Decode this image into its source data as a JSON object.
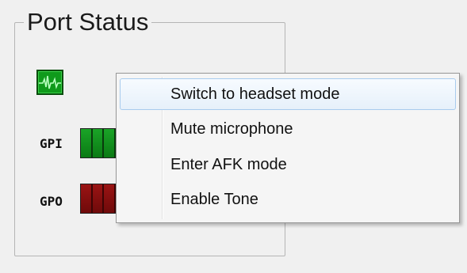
{
  "group": {
    "title": "Port Status"
  },
  "ports": {
    "gpi_label": "GPI",
    "gpo_label": "GPO"
  },
  "icons": {
    "activity": "pulse-icon"
  },
  "colors": {
    "gpi_led": "#0f9a1b",
    "gpo_led": "#7a0b0b",
    "menu_highlight_border": "#a8cbee"
  },
  "context_menu": {
    "items": [
      {
        "label": "Switch to headset mode",
        "highlighted": true
      },
      {
        "label": "Mute microphone",
        "highlighted": false
      },
      {
        "label": "Enter AFK mode",
        "highlighted": false
      },
      {
        "label": "Enable Tone",
        "highlighted": false
      }
    ]
  }
}
